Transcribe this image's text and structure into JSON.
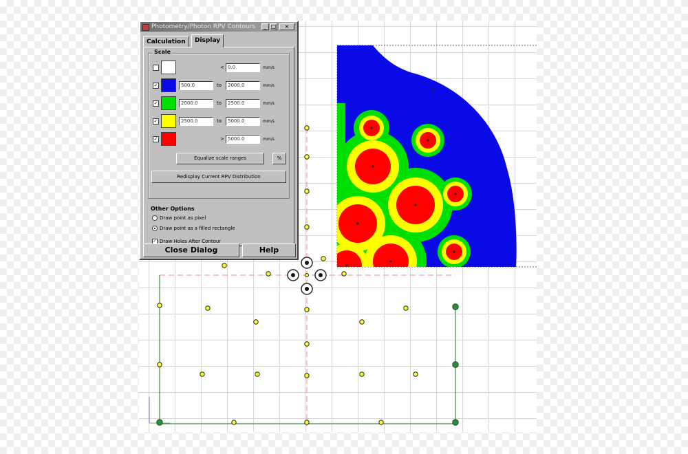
{
  "window": {
    "title": "Photometry/Photon RPV Contours",
    "minimize_glyph": "_",
    "maximize_glyph": "□",
    "close_glyph": "×"
  },
  "tabs": [
    {
      "label": "Calculation",
      "active": false
    },
    {
      "label": "Display",
      "active": true
    }
  ],
  "scale": {
    "label": "Scale",
    "rows": [
      {
        "checked": false,
        "color": "#ffffff",
        "cmp": "<",
        "from": "",
        "to": "0.0",
        "unit": "mm/s"
      },
      {
        "checked": true,
        "color": "#0a0ae6",
        "cmp": "to",
        "from": "500.0",
        "to": "2000.0",
        "unit": "mm/s"
      },
      {
        "checked": true,
        "color": "#00e000",
        "cmp": "to",
        "from": "2000.0",
        "to": "2500.0",
        "unit": "mm/s"
      },
      {
        "checked": true,
        "color": "#ffff00",
        "cmp": "to",
        "from": "2500.0",
        "to": "5000.0",
        "unit": "mm/s"
      },
      {
        "checked": true,
        "color": "#ff0000",
        "cmp": ">",
        "from": "",
        "to": "5000.0",
        "unit": "mm/s"
      }
    ],
    "equalize_label": "Equalize scale ranges",
    "percent_label": "%",
    "redisplay_label": "Redisplay Current RPV Distribution"
  },
  "other_options": {
    "label": "Other Options",
    "opt_pixel": "Draw point as pixel",
    "opt_rect": "Draw point as a filled rectangle",
    "opt_holes": "Draw Holes After Contour",
    "selected": "opt_rect",
    "holes_checked": true
  },
  "buttons": {
    "close": "Close Dialog",
    "help": "Help"
  },
  "contour_colors": {
    "blue": "#0a0ae6",
    "green": "#00e000",
    "yellow": "#ffff00",
    "red": "#ff0000"
  },
  "contour_holes": [
    {
      "r_red": 12,
      "r_yellow": 18,
      "r_green": 26
    },
    {
      "r_red": 12,
      "r_yellow": 18,
      "r_green": 24
    },
    {
      "r_red": 26,
      "r_yellow": 38,
      "r_green": 52
    },
    {
      "r_red": 12,
      "r_yellow": 18,
      "r_green": 24
    },
    {
      "r_red": 28,
      "r_yellow": 40,
      "r_green": 54
    },
    {
      "r_red": 28,
      "r_yellow": 40,
      "r_green": 54
    },
    {
      "r_red": 12,
      "r_yellow": 18,
      "r_green": 24
    },
    {
      "r_red": 26,
      "r_yellow": 38,
      "r_green": 52
    },
    {
      "r_red": 22,
      "r_yellow": 32,
      "r_green": 44
    }
  ],
  "blast_holes_count": 34,
  "corner_markers_count": 4,
  "target_rings_count": 5
}
